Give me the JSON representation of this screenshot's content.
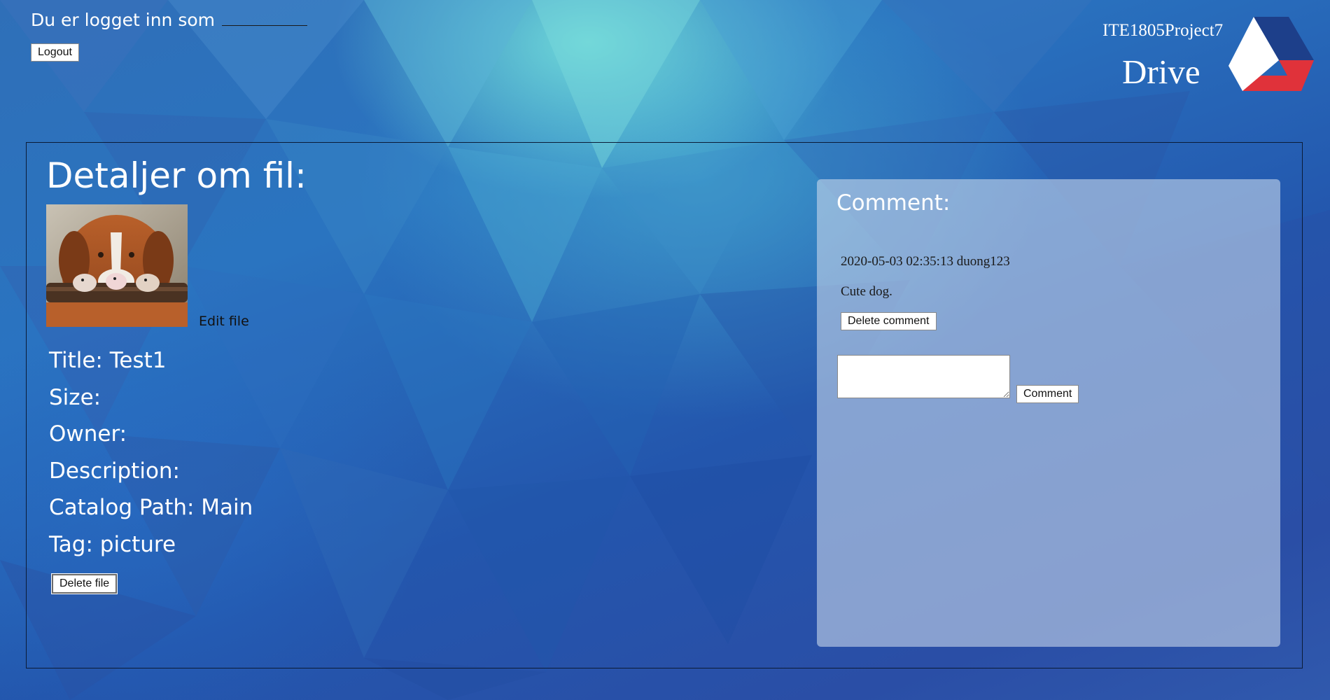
{
  "header": {
    "logged_in_label": "Du er logget inn som",
    "logged_in_user": "",
    "logout_label": "Logout",
    "brand_project": "ITE1805Project7",
    "brand_name": "Drive",
    "logo_colors": [
      "#1d3f8a",
      "#e0323a",
      "#ffffff"
    ]
  },
  "file": {
    "heading": "Detaljer om fil:",
    "edit_label": "Edit file",
    "details": [
      "Title: Test1",
      "Size:",
      "Owner:",
      "Description:",
      "Catalog Path: Main",
      "Tag: picture"
    ],
    "delete_label": "Delete file"
  },
  "comments": {
    "title": "Comment:",
    "items": [
      {
        "meta": "2020-05-03 02:35:13 duong123",
        "text": "Cute dog.",
        "delete_label": "Delete comment"
      }
    ],
    "input_value": "",
    "submit_label": "Comment"
  }
}
